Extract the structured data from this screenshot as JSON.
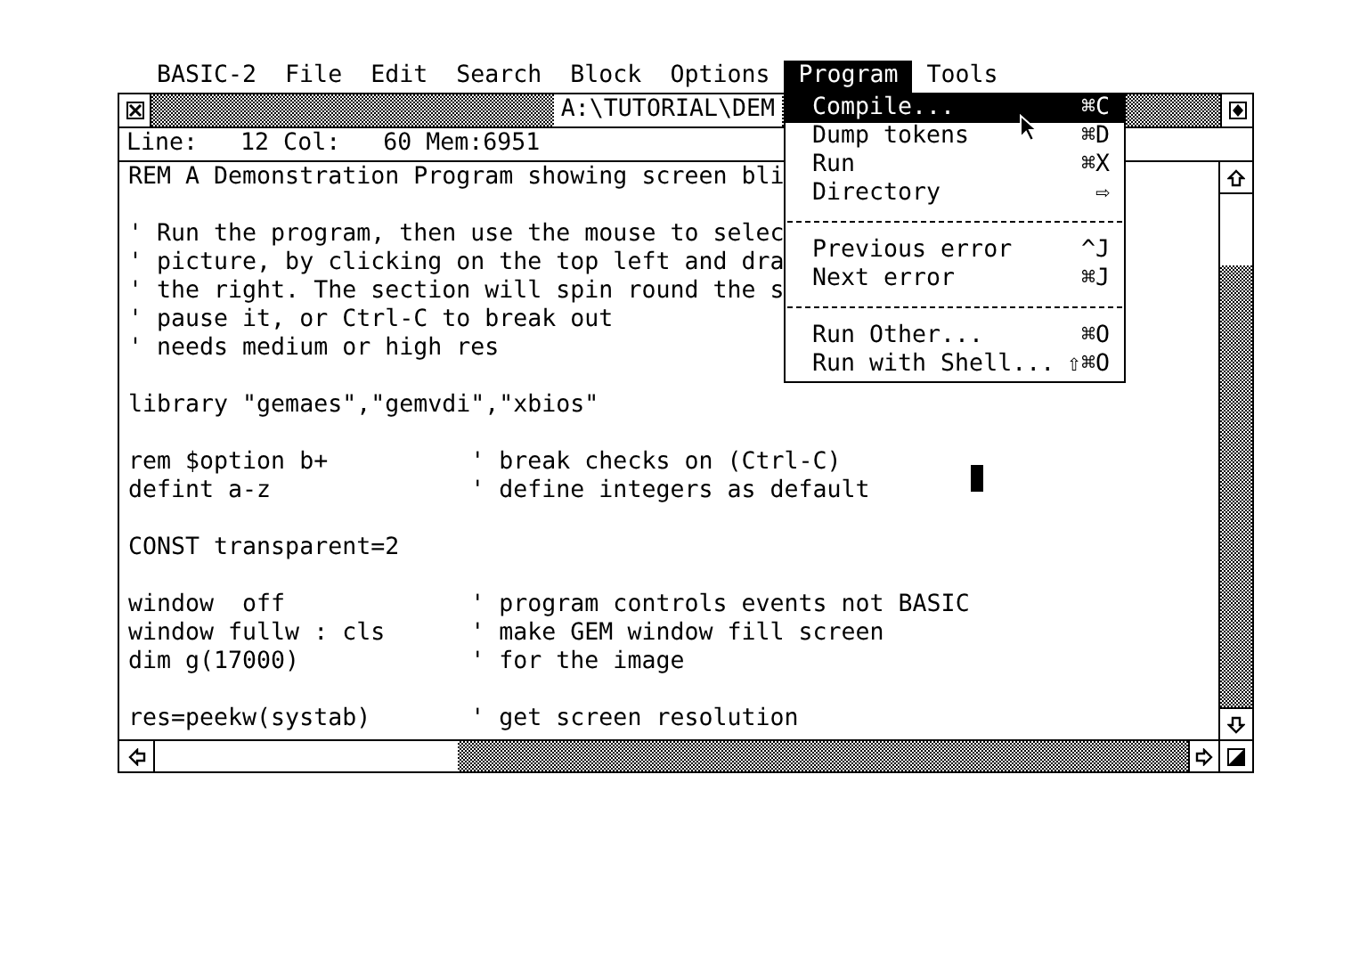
{
  "menu_bar": [
    {
      "label": "BASIC-2",
      "selected": false
    },
    {
      "label": "File",
      "selected": false
    },
    {
      "label": "Edit",
      "selected": false
    },
    {
      "label": "Search",
      "selected": false
    },
    {
      "label": "Block",
      "selected": false
    },
    {
      "label": "Options",
      "selected": false
    },
    {
      "label": "Program",
      "selected": true
    },
    {
      "label": "Tools",
      "selected": false
    }
  ],
  "window": {
    "title": "A:\\TUTORIAL\\DEM",
    "info_line": "Line:   12 Col:   60 Mem:6951"
  },
  "editor": {
    "paragraphs": [
      [
        "REM A Demonstration Program showing screen bli"
      ],
      [
        "' Run the program, then use the mouse to selec",
        "' picture, by clicking on the top left and dra",
        "' the right. The section will spin round the s",
        "' pause it, or Ctrl-C to break out",
        "' needs medium or high res"
      ],
      [
        "library \"gemaes\",\"gemvdi\",\"xbios\""
      ],
      [
        "rem $option b+          ' break checks on (Ctrl-C)",
        "defint a-z              ' define integers as default"
      ],
      [
        "CONST transparent=2"
      ],
      [
        "window  off             ' program controls events not BASIC",
        "window fullw : cls      ' make GEM window fill screen",
        "dim g(17000)            ' for the image"
      ],
      [
        "res=peekw(systab)       ' get screen resolution"
      ]
    ]
  },
  "dropdown": {
    "groups": [
      [
        {
          "label": "Compile...",
          "shortcut": "⌘C",
          "selected": true
        },
        {
          "label": "Dump tokens",
          "shortcut": "⌘D",
          "selected": false
        },
        {
          "label": "Run",
          "shortcut": "⌘X",
          "selected": false
        },
        {
          "label": "Directory",
          "shortcut": "⇨",
          "selected": false
        }
      ],
      [
        {
          "label": "Previous error",
          "shortcut": "^J",
          "selected": false
        },
        {
          "label": "Next error",
          "shortcut": "⌘J",
          "selected": false
        }
      ],
      [
        {
          "label": "Run Other...",
          "shortcut": "⌘O",
          "selected": false
        },
        {
          "label": "Run with Shell...",
          "shortcut": "⇧⌘O",
          "selected": false
        }
      ]
    ]
  }
}
